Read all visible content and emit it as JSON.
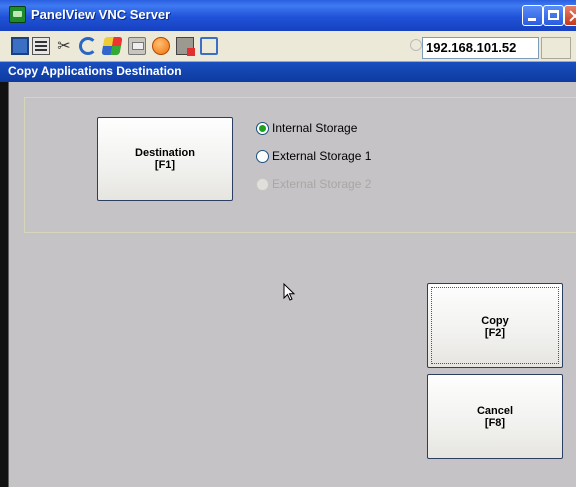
{
  "window": {
    "title": "PanelView VNC Server"
  },
  "toolbar": {
    "address": "192.168.101.52",
    "icons": [
      "vnc-options-icon",
      "connection-info-icon",
      "tools-icon",
      "refresh-icon",
      "start-menu-icon",
      "keyboard-icon",
      "alt-icon",
      "disconnect-icon",
      "fullscreen-icon"
    ]
  },
  "dialog": {
    "title": "Copy Applications Destination",
    "destination_button": {
      "line1": "Destination",
      "line2": "[F1]"
    },
    "options": [
      {
        "label": "Internal Storage",
        "selected": true,
        "enabled": true
      },
      {
        "label": "External Storage 1",
        "selected": false,
        "enabled": true
      },
      {
        "label": "External Storage 2",
        "selected": false,
        "enabled": false
      }
    ],
    "copy_button": {
      "line1": "Copy",
      "line2": "[F2]"
    },
    "cancel_button": {
      "line1": "Cancel",
      "line2": "[F8]"
    }
  },
  "colors": {
    "titlebar": "#1f52d8",
    "dialog_header": "#0c3aa0",
    "background": "#c6c3c6",
    "radio_selected": "#21a121"
  }
}
